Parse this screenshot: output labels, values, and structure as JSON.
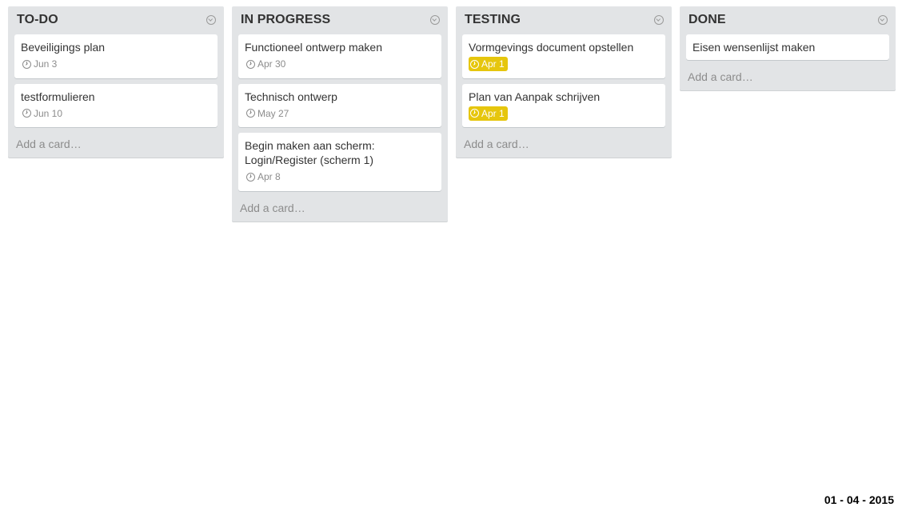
{
  "lists": [
    {
      "title": "TO-DO",
      "add_card": "Add a card…",
      "cards": [
        {
          "title": "Beveiligings plan",
          "due": "Jun 3",
          "overdue": false
        },
        {
          "title": "testformulieren",
          "due": "Jun 10",
          "overdue": false
        }
      ]
    },
    {
      "title": "IN PROGRESS",
      "add_card": "Add a card…",
      "cards": [
        {
          "title": "Functioneel ontwerp maken",
          "due": "Apr 30",
          "overdue": false
        },
        {
          "title": "Technisch ontwerp",
          "due": "May 27",
          "overdue": false
        },
        {
          "title": "Begin maken aan scherm: Login/Register (scherm 1)",
          "due": "Apr 8",
          "overdue": false
        }
      ]
    },
    {
      "title": "TESTING",
      "add_card": "Add a card…",
      "cards": [
        {
          "title": "Vormgevings document opstellen",
          "due": "Apr 1",
          "overdue": true
        },
        {
          "title": "Plan van Aanpak schrijven",
          "due": "Apr 1",
          "overdue": true
        }
      ]
    },
    {
      "title": "DONE",
      "add_card": "Add a card…",
      "cards": [
        {
          "title": "Eisen wensenlijst maken",
          "due": "",
          "overdue": false
        }
      ]
    }
  ],
  "footer": {
    "date": "01 - 04 - 2015"
  },
  "colors": {
    "list_bg": "#e2e4e6",
    "due_badge": "#e6c60d",
    "text": "#333333",
    "muted": "#8c8c8c"
  },
  "icons": {
    "list_menu": "chevron-circle-down-icon",
    "due": "clock-icon"
  }
}
